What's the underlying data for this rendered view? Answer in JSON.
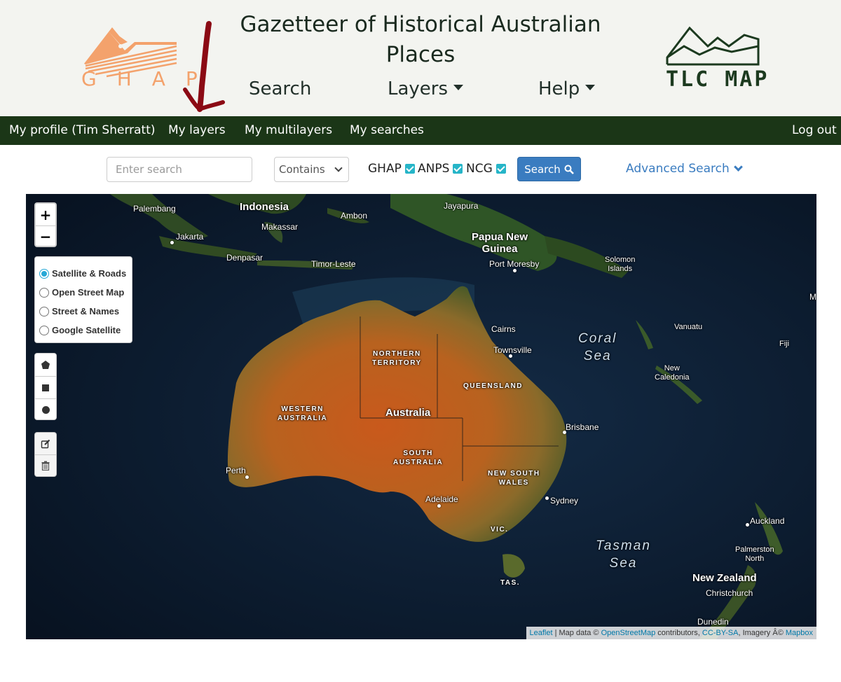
{
  "header": {
    "title": "Gazetteer of Historical Australian Places",
    "title_line1": "Gazetteer of Historical Australian",
    "title_line2": "Places",
    "ghap_logo_text": "GHAP",
    "ghap_letters": [
      "G",
      "H",
      "A",
      "P"
    ],
    "tlc_logo_text": "TLC MAP",
    "menu": {
      "search": "Search",
      "layers": "Layers",
      "help": "Help"
    }
  },
  "navbar": {
    "profile": "My profile (Tim Sherratt)",
    "layers": "My layers",
    "multilayers": "My multilayers",
    "searches": "My searches",
    "logout": "Log out"
  },
  "search": {
    "placeholder": "Enter search",
    "match_mode": "Contains",
    "sources": [
      {
        "label": "GHAP",
        "checked": true
      },
      {
        "label": "ANPS",
        "checked": true
      },
      {
        "label": "NCG",
        "checked": true
      }
    ],
    "button_label": "Search",
    "advanced_label": "Advanced Search",
    "accent_color": "#3a7cc0",
    "checkbox_color": "#26b5c8"
  },
  "map": {
    "zoom_in": "+",
    "zoom_out": "−",
    "base_layers": [
      {
        "label": "Satellite & Roads",
        "selected": true
      },
      {
        "label": "Open Street Map",
        "selected": false
      },
      {
        "label": "Street & Names",
        "selected": false
      },
      {
        "label": "Google Satellite",
        "selected": false
      }
    ],
    "draw_tools": [
      "polygon-icon",
      "rectangle-icon",
      "circle-icon"
    ],
    "edit_tools": [
      "edit-icon",
      "trash-icon"
    ],
    "labels": {
      "palembang": "Palembang",
      "indonesia": "Indonesia",
      "ambon": "Ambon",
      "jayapura": "Jayapura",
      "makassar": "Makassar",
      "jakarta": "Jakarta",
      "papua_new_guinea_1": "Papua New",
      "papua_new_guinea_2": "Guinea",
      "denpasar": "Denpasar",
      "timor_leste": "Timor-Leste",
      "port_moresby": "Port Moresby",
      "solomon_1": "Solomon",
      "solomon_2": "Islands",
      "cairns": "Cairns",
      "townsville": "Townsville",
      "coral_sea_1": "Coral",
      "coral_sea_2": "Sea",
      "vanuatu": "Vanuatu",
      "fiji": "Fiji",
      "new_caledonia_1": "New",
      "new_caledonia_2": "Caledonia",
      "northern_territory_1": "NORTHERN",
      "northern_territory_2": "TERRITORY",
      "queensland": "QUEENSLAND",
      "western_australia_1": "WESTERN",
      "western_australia_2": "AUSTRALIA",
      "australia": "Australia",
      "south_australia_1": "SOUTH",
      "south_australia_2": "AUSTRALIA",
      "brisbane": "Brisbane",
      "perth": "Perth",
      "new_south_wales_1": "NEW SOUTH",
      "new_south_wales_2": "WALES",
      "adelaide": "Adelaide",
      "sydney": "Sydney",
      "vic": "VIC.",
      "tasman_sea_1": "Tasman",
      "tasman_sea_2": "Sea",
      "auckland": "Auckland",
      "palmerston_north_1": "Palmerston",
      "palmerston_north_2": "North",
      "new_zealand": "New Zealand",
      "christchurch": "Christchurch",
      "tas": "TAS.",
      "dunedin": "Dunedin",
      "edge_m": "M"
    },
    "attribution": {
      "leaflet": "Leaflet",
      "sep1": " | Map data © ",
      "osm": "OpenStreetMap",
      "mid": " contributors, ",
      "ccbysa": "CC-BY-SA",
      "imagery": ", Imagery Â© ",
      "mapbox": "Mapbox"
    }
  },
  "colors": {
    "header_bg": "#f3f4f0",
    "navbar_bg": "#1b3617",
    "ghap_orange": "#f3a26c",
    "tlc_green": "#1c3a1f",
    "annotation_red": "#8b0a14"
  }
}
